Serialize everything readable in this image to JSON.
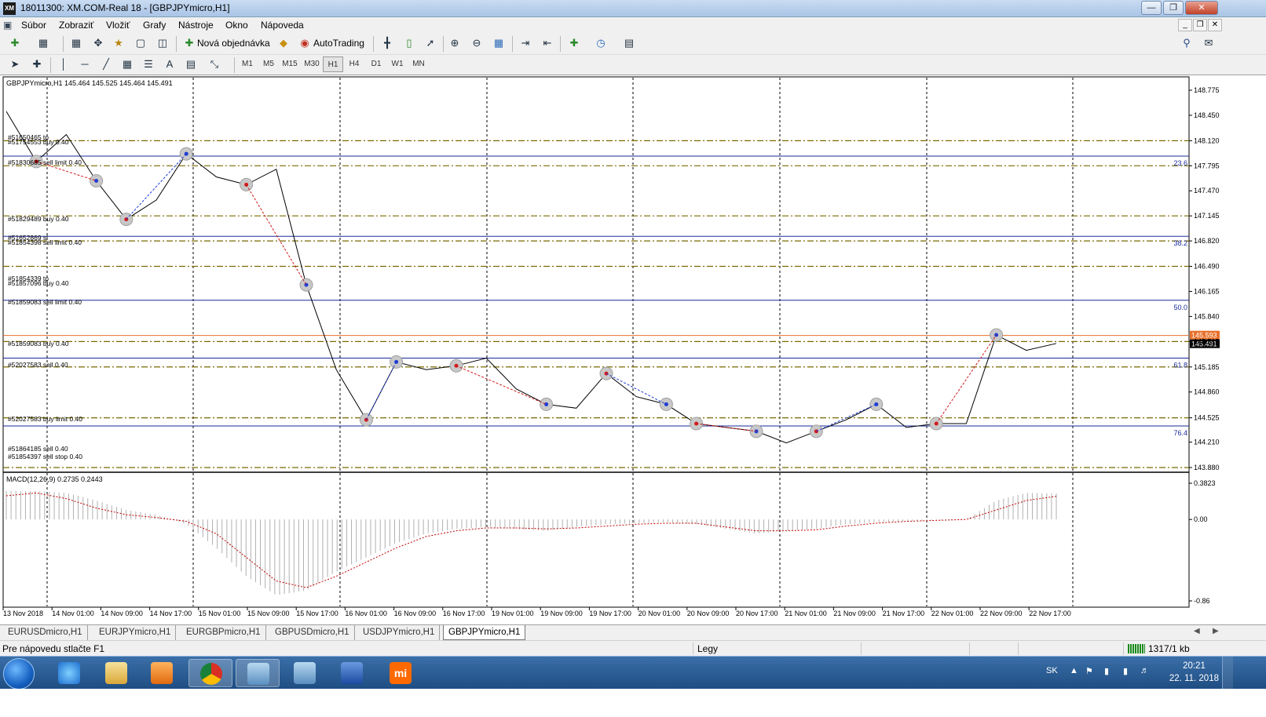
{
  "window": {
    "app_icon": "XM",
    "title": "18011300: XM.COM-Real 18 - [GBPJPYmicro,H1]"
  },
  "menu": {
    "items": [
      "Súbor",
      "Zobraziť",
      "Vložiť",
      "Grafy",
      "Nástroje",
      "Okno",
      "Nápoveda"
    ]
  },
  "toolbar1": {
    "new_order_label": "Nová objednávka",
    "autotrading_label": "AutoTrading"
  },
  "toolbar2": {
    "timeframes": [
      "M1",
      "M5",
      "M15",
      "M30",
      "H1",
      "H4",
      "D1",
      "W1",
      "MN"
    ],
    "active_timeframe": "H1",
    "text_tool": "A"
  },
  "chart": {
    "header": "GBPJPYmicro,H1  145.464 145.525 145.464 145.491",
    "price_axis": [
      "148.775",
      "148.450",
      "148.120",
      "147.795",
      "147.470",
      "147.145",
      "146.820",
      "146.490",
      "146.165",
      "145.840",
      "145.515",
      "145.185",
      "144.860",
      "144.525",
      "144.210",
      "143.880"
    ],
    "current_price": "145.491",
    "ask_price": "145.593",
    "fib_labels": [
      "23.6",
      "38.2",
      "50.0",
      "61.8",
      "76.4"
    ],
    "order_labels": [
      "#51650465 tp",
      "#51754553 buy 0.40",
      "#51830685 sell limit 0.40",
      "#51829489 buy 0.40",
      "#51652869 sl",
      "#51854398 sell limit 0.40",
      "#51854339 tp",
      "#51857096 buy 0.40",
      "#51859083 sell limit 0.40",
      "#51859083 buy 0.40",
      "#52027583 sell 0.40",
      "#52027583 buy limit 0.40",
      "#51864185 sell 0.40",
      "#51854397 sell stop 0.40"
    ],
    "time_axis": [
      "13 Nov 2018",
      "14 Nov 01:00",
      "14 Nov 09:00",
      "14 Nov 17:00",
      "15 Nov 01:00",
      "15 Nov 09:00",
      "15 Nov 17:00",
      "16 Nov 01:00",
      "16 Nov 09:00",
      "16 Nov 17:00",
      "19 Nov 01:00",
      "19 Nov 09:00",
      "19 Nov 17:00",
      "20 Nov 01:00",
      "20 Nov 09:00",
      "20 Nov 17:00",
      "21 Nov 01:00",
      "21 Nov 09:00",
      "21 Nov 17:00",
      "22 Nov 01:00",
      "22 Nov 09:00",
      "22 Nov 17:00"
    ],
    "macd_header": "MACD(12,26,9) 0.2735 0.2443",
    "macd_axis": [
      "0.3823",
      "0.00",
      "-0.86"
    ]
  },
  "chart_data": {
    "type": "line",
    "title": "GBPJPYmicro,H1",
    "series": [
      {
        "name": "",
        "values": [
          148.5,
          147.85,
          148.2,
          147.6,
          147.1,
          147.35,
          147.95,
          147.65,
          147.55,
          147.75,
          146.25,
          145.15,
          144.5,
          145.25,
          145.15,
          145.2,
          145.3,
          144.9,
          144.7,
          144.65,
          145.1,
          144.8,
          144.7,
          144.45,
          144.4,
          144.35,
          144.2,
          144.35,
          144.5,
          144.7,
          144.4,
          144.45,
          144.45,
          145.6,
          145.4,
          145.49
        ]
      }
    ],
    "ylim": [
      143.88,
      148.775
    ],
    "price_gridlines": [
      "148.120",
      "147.795",
      "147.145",
      "146.820",
      "146.490",
      "145.515",
      "145.185",
      "144.525",
      "143.880"
    ],
    "macd": {
      "value": 0.2735,
      "signal": 0.2443,
      "ylim": [
        -0.86,
        0.3823
      ]
    }
  },
  "tabs": {
    "items": [
      "EURUSDmicro,H1",
      "EURJPYmicro,H1",
      "EURGBPmicro,H1",
      "GBPUSDmicro,H1",
      "USDJPYmicro,H1",
      "GBPJPYmicro,H1"
    ],
    "active": "GBPJPYmicro,H1"
  },
  "status": {
    "help_text": "Pre nápovedu stlačte F1",
    "profile": "Legy",
    "connection": "1317/1 kb"
  },
  "taskbar": {
    "lang": "SK",
    "time": "20:21",
    "date": "22. 11. 2018",
    "mi_label": "mi"
  },
  "colors": {
    "candle_line": "#000000",
    "buy_color": "#1f3dd6",
    "sell_color": "#d21a1a",
    "fib_color": "#1a2b9a",
    "order_line": "#7a6a00",
    "macd_signal": "#c00000",
    "ask_line": "#e8702a"
  }
}
